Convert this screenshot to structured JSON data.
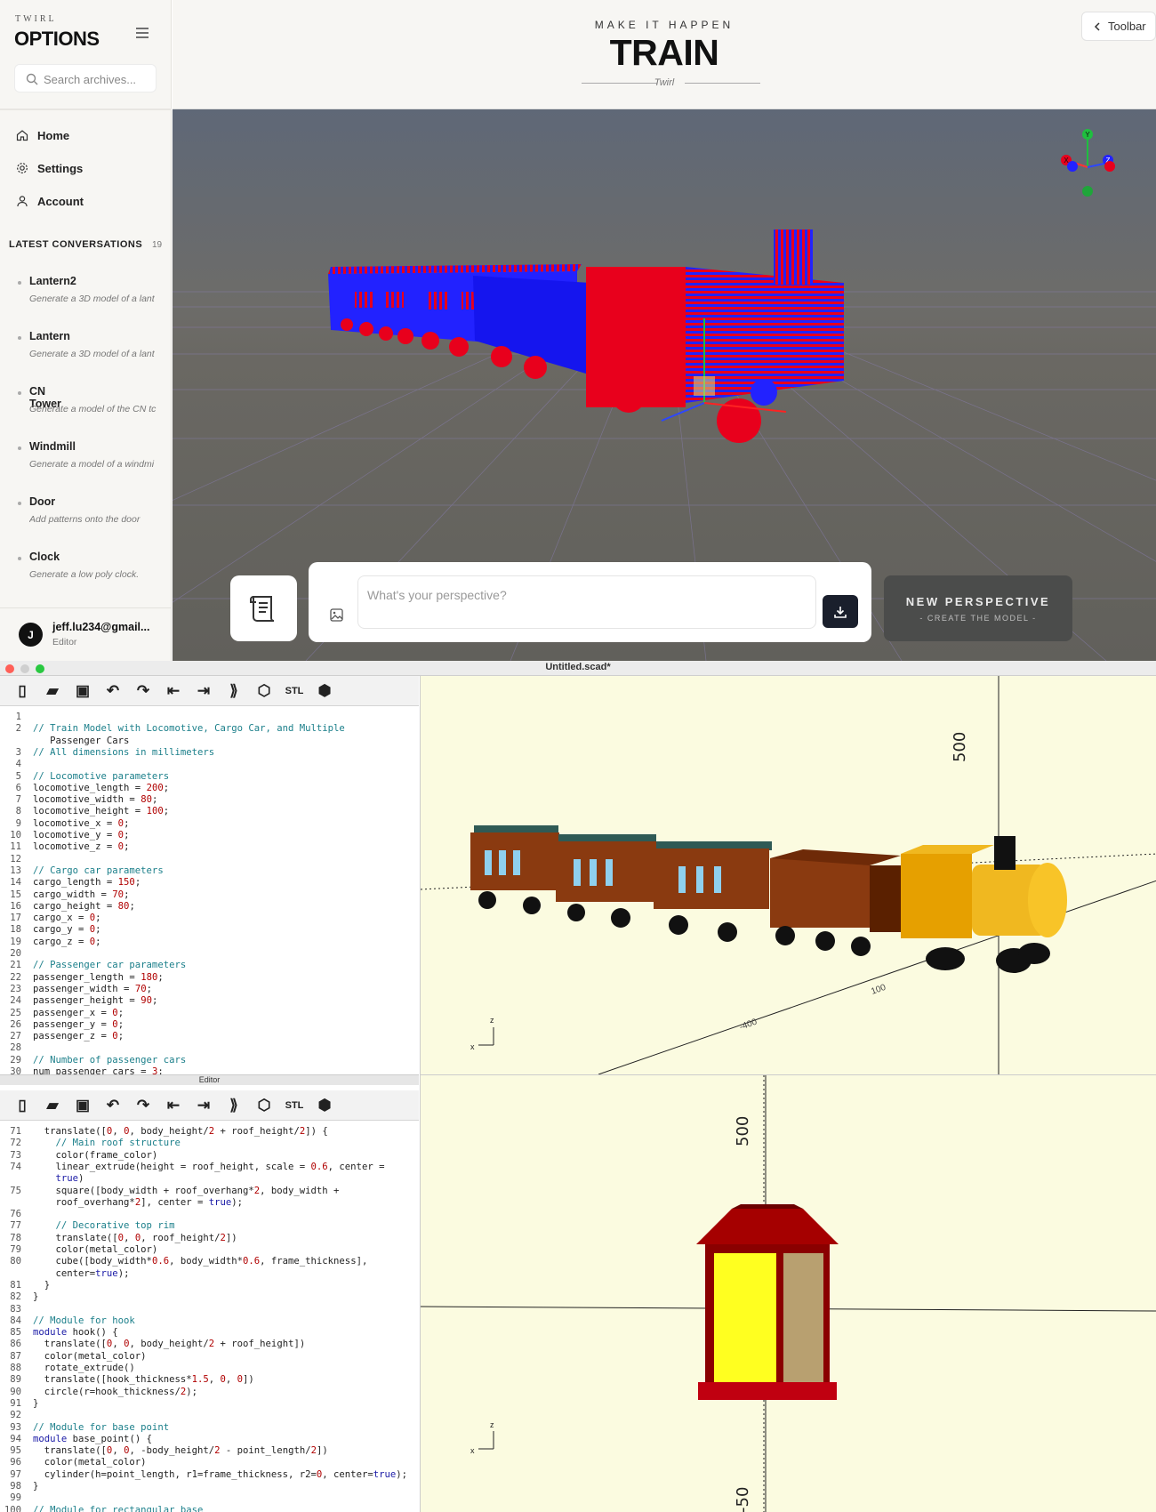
{
  "sidebar": {
    "brand_small": "TWIRL",
    "brand_title": "OPTIONS",
    "search_placeholder": "Search archives...",
    "nav": [
      {
        "label": "Home",
        "icon": "home-icon"
      },
      {
        "label": "Settings",
        "icon": "gear-icon"
      },
      {
        "label": "Account",
        "icon": "user-icon"
      }
    ],
    "latest_label": "LATEST CONVERSATIONS",
    "latest_count": "19",
    "conversations": [
      {
        "title": "Lantern2",
        "subtitle": "Generate a 3D model of a lant"
      },
      {
        "title": "Lantern",
        "subtitle": "Generate a 3D model of a lant"
      },
      {
        "title": "CN Tower",
        "subtitle": "Generate a model of the CN tc"
      },
      {
        "title": "Windmill",
        "subtitle": "Generate a model of a windmi"
      },
      {
        "title": "Door",
        "subtitle": "Add patterns onto the door"
      },
      {
        "title": "Clock",
        "subtitle": "Generate a low poly clock."
      }
    ],
    "user": {
      "initial": "J",
      "email": "jeff.lu234@gmail...",
      "role": "Editor"
    }
  },
  "header": {
    "tagline": "MAKE IT HAPPEN",
    "title": "TRAIN",
    "subtitle": "Twirl",
    "toolbar_label": "Toolbar"
  },
  "prompt": {
    "placeholder": "What's your perspective?",
    "new_perspective": "NEW PERSPECTIVE",
    "create_model": "- CREATE THE MODEL -"
  },
  "openscad": {
    "window_title": "Untitled.scad*",
    "editor_label": "Editor",
    "stl_label": "STL",
    "editor1_lines": [
      {
        "n": "1",
        "t": ""
      },
      {
        "n": "2",
        "t": "// Train Model with Locomotive, Cargo Car, and Multiple"
      },
      {
        "n": "",
        "t": "   Passenger Cars"
      },
      {
        "n": "3",
        "t": "// All dimensions in millimeters"
      },
      {
        "n": "4",
        "t": ""
      },
      {
        "n": "5",
        "t": "// Locomotive parameters"
      },
      {
        "n": "6",
        "t": "locomotive_length = 200;"
      },
      {
        "n": "7",
        "t": "locomotive_width = 80;"
      },
      {
        "n": "8",
        "t": "locomotive_height = 100;"
      },
      {
        "n": "9",
        "t": "locomotive_x = 0;"
      },
      {
        "n": "10",
        "t": "locomotive_y = 0;"
      },
      {
        "n": "11",
        "t": "locomotive_z = 0;"
      },
      {
        "n": "12",
        "t": ""
      },
      {
        "n": "13",
        "t": "// Cargo car parameters"
      },
      {
        "n": "14",
        "t": "cargo_length = 150;"
      },
      {
        "n": "15",
        "t": "cargo_width = 70;"
      },
      {
        "n": "16",
        "t": "cargo_height = 80;"
      },
      {
        "n": "17",
        "t": "cargo_x = 0;"
      },
      {
        "n": "18",
        "t": "cargo_y = 0;"
      },
      {
        "n": "19",
        "t": "cargo_z = 0;"
      },
      {
        "n": "20",
        "t": ""
      },
      {
        "n": "21",
        "t": "// Passenger car parameters"
      },
      {
        "n": "22",
        "t": "passenger_length = 180;"
      },
      {
        "n": "23",
        "t": "passenger_width = 70;"
      },
      {
        "n": "24",
        "t": "passenger_height = 90;"
      },
      {
        "n": "25",
        "t": "passenger_x = 0;"
      },
      {
        "n": "26",
        "t": "passenger_y = 0;"
      },
      {
        "n": "27",
        "t": "passenger_z = 0;"
      },
      {
        "n": "28",
        "t": ""
      },
      {
        "n": "29",
        "t": "// Number of passenger cars"
      },
      {
        "n": "30",
        "t": "num_passenger_cars = 3;"
      }
    ],
    "editor2_lines": [
      {
        "n": "71",
        "t": "  translate([0, 0, body_height/2 + roof_height/2]) {"
      },
      {
        "n": "72",
        "t": "    // Main roof structure"
      },
      {
        "n": "73",
        "t": "    color(frame_color)"
      },
      {
        "n": "74",
        "t": "    linear_extrude(height = roof_height, scale = 0.6, center ="
      },
      {
        "n": "",
        "t": "    true)"
      },
      {
        "n": "75",
        "t": "    square([body_width + roof_overhang*2, body_width +"
      },
      {
        "n": "",
        "t": "    roof_overhang*2], center = true);"
      },
      {
        "n": "76",
        "t": ""
      },
      {
        "n": "77",
        "t": "    // Decorative top rim"
      },
      {
        "n": "78",
        "t": "    translate([0, 0, roof_height/2])"
      },
      {
        "n": "79",
        "t": "    color(metal_color)"
      },
      {
        "n": "80",
        "t": "    cube([body_width*0.6, body_width*0.6, frame_thickness],"
      },
      {
        "n": "",
        "t": "    center=true);"
      },
      {
        "n": "81",
        "t": "  }"
      },
      {
        "n": "82",
        "t": "}"
      },
      {
        "n": "83",
        "t": ""
      },
      {
        "n": "84",
        "t": "// Module for hook"
      },
      {
        "n": "85",
        "t": "module hook() {"
      },
      {
        "n": "86",
        "t": "  translate([0, 0, body_height/2 + roof_height])"
      },
      {
        "n": "87",
        "t": "  color(metal_color)"
      },
      {
        "n": "88",
        "t": "  rotate_extrude()"
      },
      {
        "n": "89",
        "t": "  translate([hook_thickness*1.5, 0, 0])"
      },
      {
        "n": "90",
        "t": "  circle(r=hook_thickness/2);"
      },
      {
        "n": "91",
        "t": "}"
      },
      {
        "n": "92",
        "t": ""
      },
      {
        "n": "93",
        "t": "// Module for base point"
      },
      {
        "n": "94",
        "t": "module base_point() {"
      },
      {
        "n": "95",
        "t": "  translate([0, 0, -body_height/2 - point_length/2])"
      },
      {
        "n": "96",
        "t": "  color(metal_color)"
      },
      {
        "n": "97",
        "t": "  cylinder(h=point_length, r1=frame_thickness, r2=0, center=true);"
      },
      {
        "n": "98",
        "t": "}"
      },
      {
        "n": "99",
        "t": ""
      },
      {
        "n": "100",
        "t": "// Module for rectangular base"
      }
    ],
    "axis_label_500": "500",
    "axis_label_500b": "500",
    "axis_label_neg": "-50",
    "axis_label_100": "100",
    "axis_label_400": "-400",
    "axis_z": "z",
    "axis_x": "x",
    "gizmo": {
      "x": "X",
      "y": "Y",
      "z": "Z"
    }
  },
  "colors": {
    "accent_dark": "#1a1f2c",
    "train_red": "#e8001c",
    "train_blue": "#1a1aff",
    "openscad_bg": "#fbfbe0"
  }
}
